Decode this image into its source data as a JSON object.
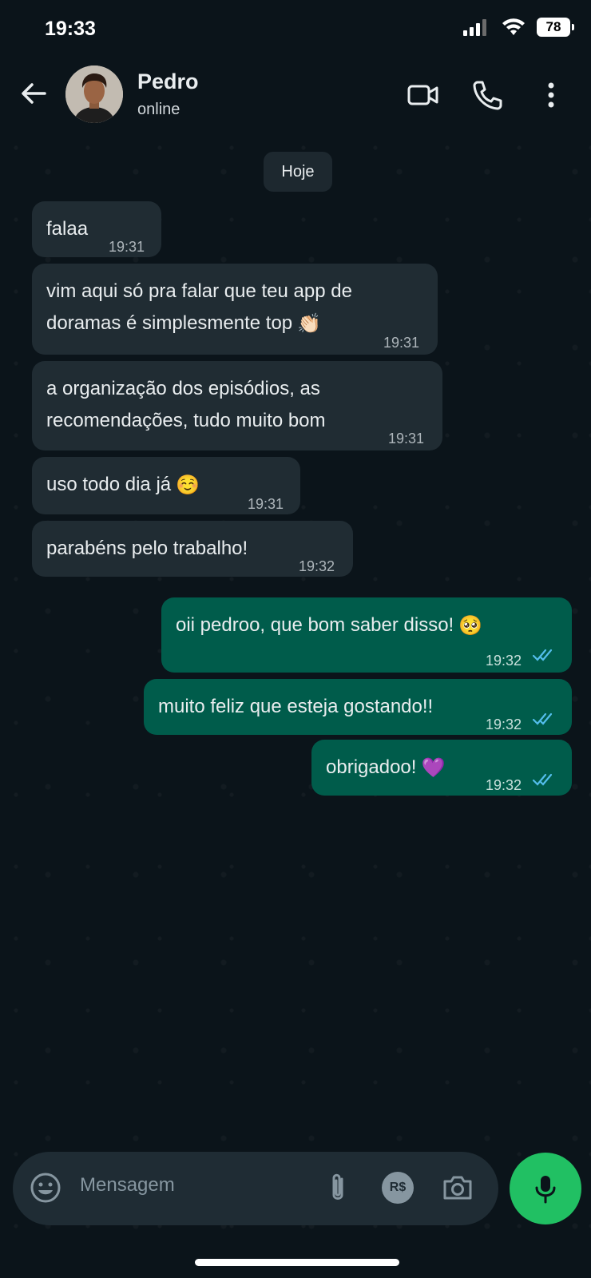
{
  "status_bar": {
    "time": "19:33",
    "battery": "78"
  },
  "header": {
    "back_icon": "arrow-left-icon",
    "contact_name": "Pedro",
    "contact_status": "online",
    "video_icon": "video-call-icon",
    "call_icon": "phone-icon",
    "menu_icon": "more-vertical-icon"
  },
  "date_chip": "Hoje",
  "messages": [
    {
      "direction": "in",
      "text": "falaa",
      "time": "19:31"
    },
    {
      "direction": "in",
      "text_line1": "vim aqui só pra falar que teu app de",
      "text_line2": "doramas é simplesmente top",
      "emoji": "👏🏻",
      "time": "19:31"
    },
    {
      "direction": "in",
      "text_line1": "a organização dos episódios, as",
      "text_line2": "recomendações, tudo muito bom",
      "time": "19:31"
    },
    {
      "direction": "in",
      "text": "uso todo dia já",
      "emoji": "☺️",
      "time": "19:31"
    },
    {
      "direction": "in",
      "text": "parabéns pelo trabalho!",
      "time": "19:32"
    },
    {
      "direction": "out",
      "text": "oii pedroo, que bom saber disso!",
      "emoji": "🥺",
      "time": "19:32",
      "status": "read"
    },
    {
      "direction": "out",
      "text": "muito feliz que esteja gostando!!",
      "time": "19:32",
      "status": "read"
    },
    {
      "direction": "out",
      "text": "obrigadoo!",
      "emoji": "💜",
      "time": "19:32",
      "status": "read"
    }
  ],
  "composer": {
    "placeholder": "Mensagem",
    "emoji_icon": "emoji-icon",
    "attach_icon": "paperclip-icon",
    "payment_icon": "payment-brl-icon",
    "payment_label": "R$",
    "camera_icon": "camera-icon",
    "mic_icon": "microphone-icon"
  },
  "colors": {
    "background": "#0b141a",
    "incoming_bubble": "#202c33",
    "outgoing_bubble": "#005c4b",
    "read_ticks": "#53bdeb",
    "mic_button": "#21c063"
  }
}
